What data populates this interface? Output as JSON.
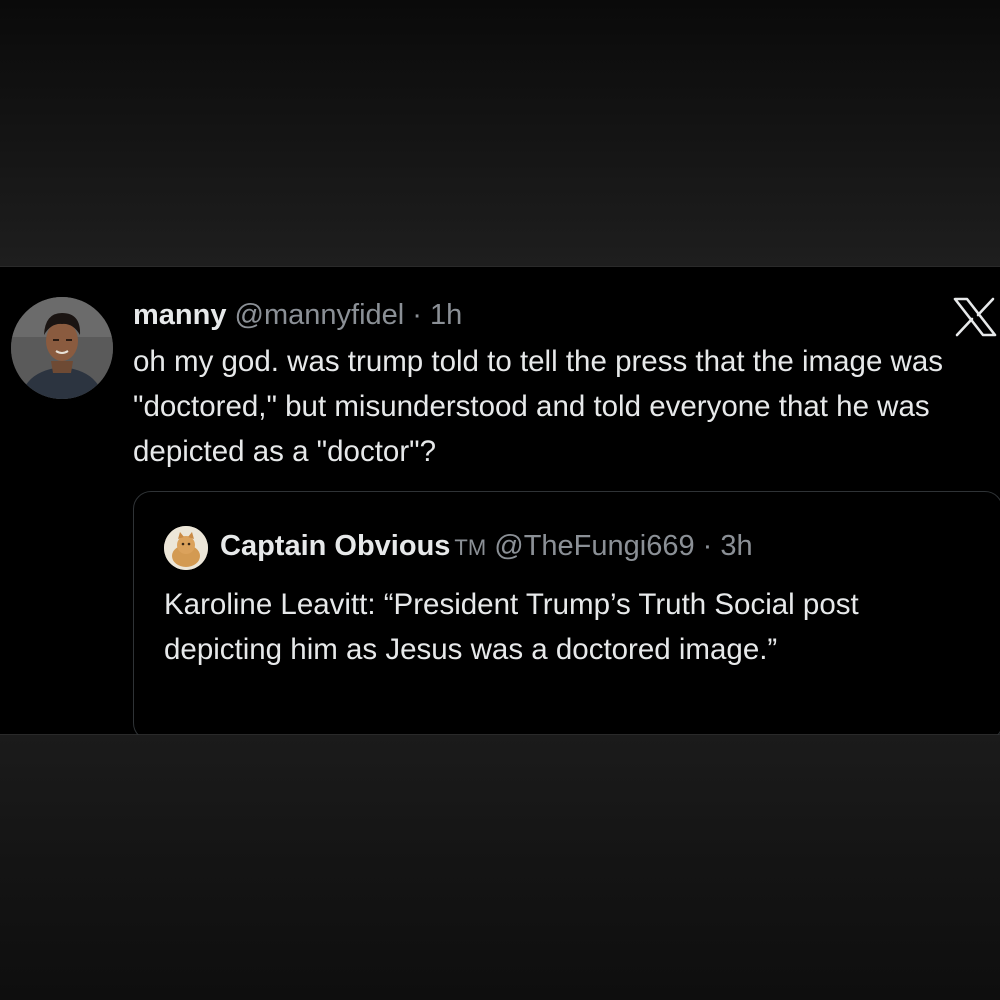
{
  "tweet": {
    "author_name": "manny",
    "author_handle": "@mannyfidel",
    "separator": "·",
    "time": "1h",
    "text": "oh my god. was trump told to tell the press that the image was \"doctored,\" but misunderstood and told everyone that he was depicted as a \"doctor\"?"
  },
  "quoted_tweet": {
    "author_name": "Captain Obvious",
    "author_badge": "TM",
    "author_handle": "@TheFungi669",
    "separator": "·",
    "time": "3h",
    "text": "Karoline Leavitt: “President Trump’s Truth Social post depicting him as Jesus was a doctored image.”"
  },
  "icons": {
    "brand": "x-logo-icon"
  },
  "colors": {
    "card_background": "#000000",
    "primary_text": "#e7e9ea",
    "secondary_text": "#8b9096",
    "border": "#2f3336"
  }
}
